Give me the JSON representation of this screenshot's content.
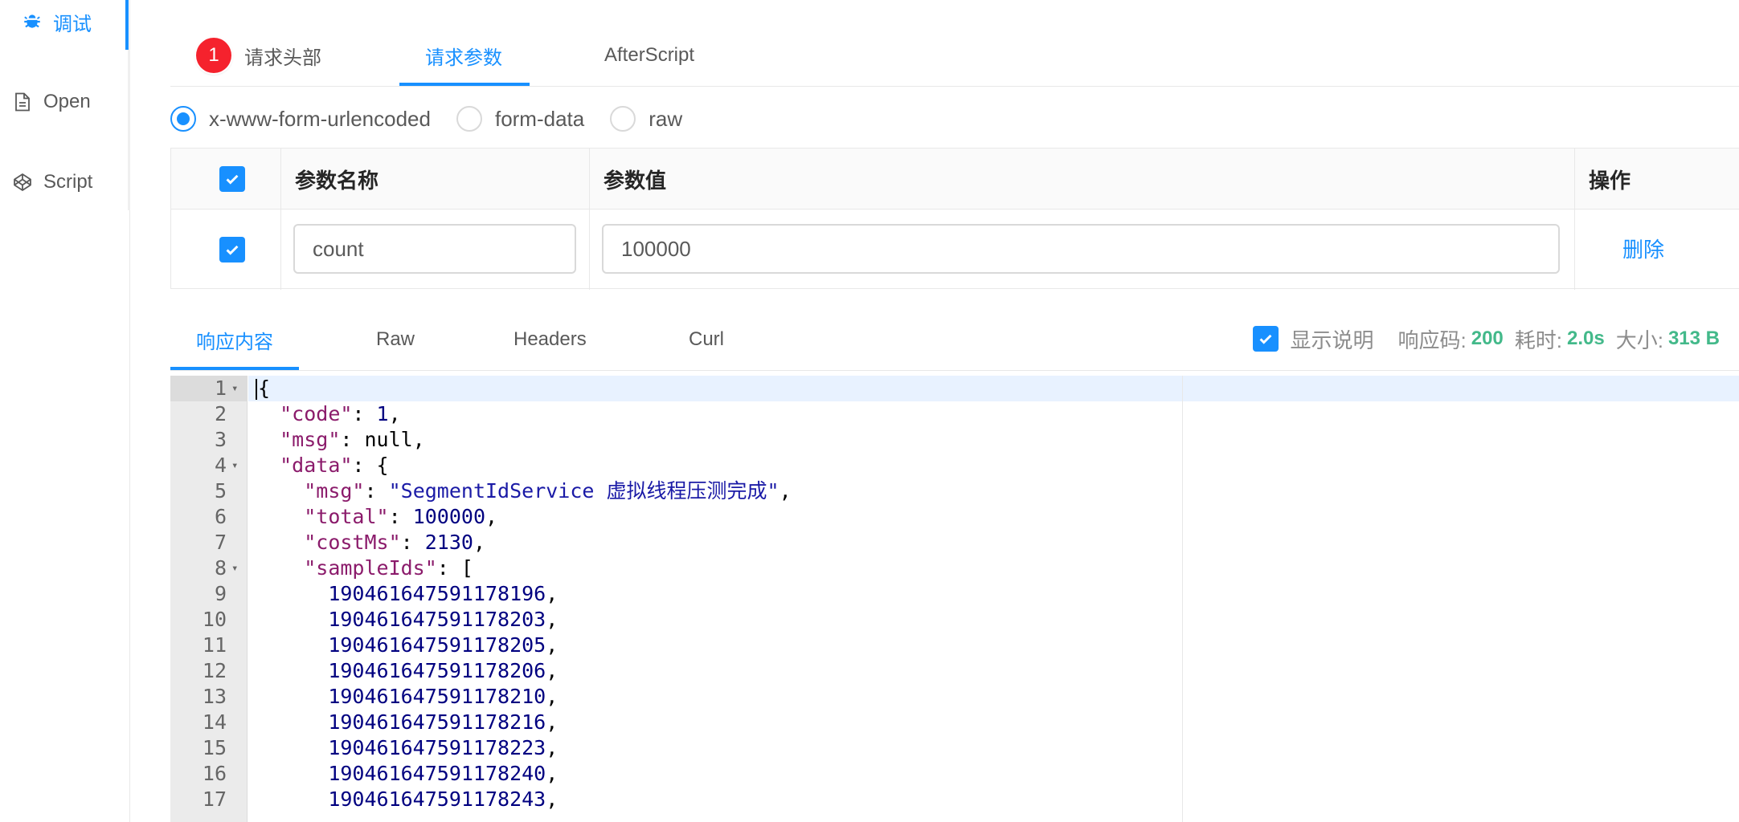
{
  "sidebar": {
    "items": [
      {
        "label": "调试",
        "icon": "bug-icon",
        "active": true
      },
      {
        "label": "Open",
        "icon": "file-icon",
        "active": false
      },
      {
        "label": "Script",
        "icon": "codepen-icon",
        "active": false
      }
    ]
  },
  "request_tabs": {
    "badge": "1",
    "items": [
      {
        "label": "请求头部",
        "active": false
      },
      {
        "label": "请求参数",
        "active": true
      },
      {
        "label": "AfterScript",
        "active": false
      }
    ]
  },
  "body_type": {
    "options": [
      "x-www-form-urlencoded",
      "form-data",
      "raw"
    ],
    "selected": "x-www-form-urlencoded"
  },
  "params_table": {
    "headers": {
      "name": "参数名称",
      "value": "参数值",
      "action": "操作"
    },
    "rows": [
      {
        "checked": true,
        "name": "count",
        "value": "100000",
        "action": "删除"
      }
    ]
  },
  "response_tabs": {
    "items": [
      {
        "label": "响应内容",
        "active": true
      },
      {
        "label": "Raw",
        "active": false
      },
      {
        "label": "Headers",
        "active": false
      },
      {
        "label": "Curl",
        "active": false
      }
    ]
  },
  "response_meta": {
    "show_desc_label": "显示说明",
    "show_desc_checked": true,
    "code_label": "响应码:",
    "code_value": "200",
    "time_label": "耗时:",
    "time_value": "2.0s",
    "size_label": "大小:",
    "size_value": "313 B"
  },
  "code_lines": [
    {
      "n": "1",
      "fold": true,
      "parts": [
        [
          "p",
          "{"
        ]
      ]
    },
    {
      "n": "2",
      "fold": false,
      "parts": [
        [
          "p",
          "  "
        ],
        [
          "k",
          "\"code\""
        ],
        [
          "p",
          ": "
        ],
        [
          "n",
          "1"
        ],
        [
          "p",
          ","
        ]
      ]
    },
    {
      "n": "3",
      "fold": false,
      "parts": [
        [
          "p",
          "  "
        ],
        [
          "k",
          "\"msg\""
        ],
        [
          "p",
          ": null,"
        ]
      ]
    },
    {
      "n": "4",
      "fold": true,
      "parts": [
        [
          "p",
          "  "
        ],
        [
          "k",
          "\"data\""
        ],
        [
          "p",
          ": {"
        ]
      ]
    },
    {
      "n": "5",
      "fold": false,
      "parts": [
        [
          "p",
          "    "
        ],
        [
          "k",
          "\"msg\""
        ],
        [
          "p",
          ": "
        ],
        [
          "s",
          "\"SegmentIdService 虚拟线程压测完成\""
        ],
        [
          "p",
          ","
        ]
      ]
    },
    {
      "n": "6",
      "fold": false,
      "parts": [
        [
          "p",
          "    "
        ],
        [
          "k",
          "\"total\""
        ],
        [
          "p",
          ": "
        ],
        [
          "n",
          "100000"
        ],
        [
          "p",
          ","
        ]
      ]
    },
    {
      "n": "7",
      "fold": false,
      "parts": [
        [
          "p",
          "    "
        ],
        [
          "k",
          "\"costMs\""
        ],
        [
          "p",
          ": "
        ],
        [
          "n",
          "2130"
        ],
        [
          "p",
          ","
        ]
      ]
    },
    {
      "n": "8",
      "fold": true,
      "parts": [
        [
          "p",
          "    "
        ],
        [
          "k",
          "\"sampleIds\""
        ],
        [
          "p",
          ": ["
        ]
      ]
    },
    {
      "n": "9",
      "fold": false,
      "parts": [
        [
          "p",
          "      "
        ],
        [
          "n",
          "190461647591178196"
        ],
        [
          "p",
          ","
        ]
      ]
    },
    {
      "n": "10",
      "fold": false,
      "parts": [
        [
          "p",
          "      "
        ],
        [
          "n",
          "190461647591178203"
        ],
        [
          "p",
          ","
        ]
      ]
    },
    {
      "n": "11",
      "fold": false,
      "parts": [
        [
          "p",
          "      "
        ],
        [
          "n",
          "190461647591178205"
        ],
        [
          "p",
          ","
        ]
      ]
    },
    {
      "n": "12",
      "fold": false,
      "parts": [
        [
          "p",
          "      "
        ],
        [
          "n",
          "190461647591178206"
        ],
        [
          "p",
          ","
        ]
      ]
    },
    {
      "n": "13",
      "fold": false,
      "parts": [
        [
          "p",
          "      "
        ],
        [
          "n",
          "190461647591178210"
        ],
        [
          "p",
          ","
        ]
      ]
    },
    {
      "n": "14",
      "fold": false,
      "parts": [
        [
          "p",
          "      "
        ],
        [
          "n",
          "190461647591178216"
        ],
        [
          "p",
          ","
        ]
      ]
    },
    {
      "n": "15",
      "fold": false,
      "parts": [
        [
          "p",
          "      "
        ],
        [
          "n",
          "190461647591178223"
        ],
        [
          "p",
          ","
        ]
      ]
    },
    {
      "n": "16",
      "fold": false,
      "parts": [
        [
          "p",
          "      "
        ],
        [
          "n",
          "190461647591178240"
        ],
        [
          "p",
          ","
        ]
      ]
    },
    {
      "n": "17",
      "fold": false,
      "parts": [
        [
          "p",
          "      "
        ],
        [
          "n",
          "190461647591178243"
        ],
        [
          "p",
          ","
        ]
      ]
    }
  ],
  "colors": {
    "accent": "#1890ff",
    "badge": "#f5222d",
    "status_value": "#43b98a"
  }
}
